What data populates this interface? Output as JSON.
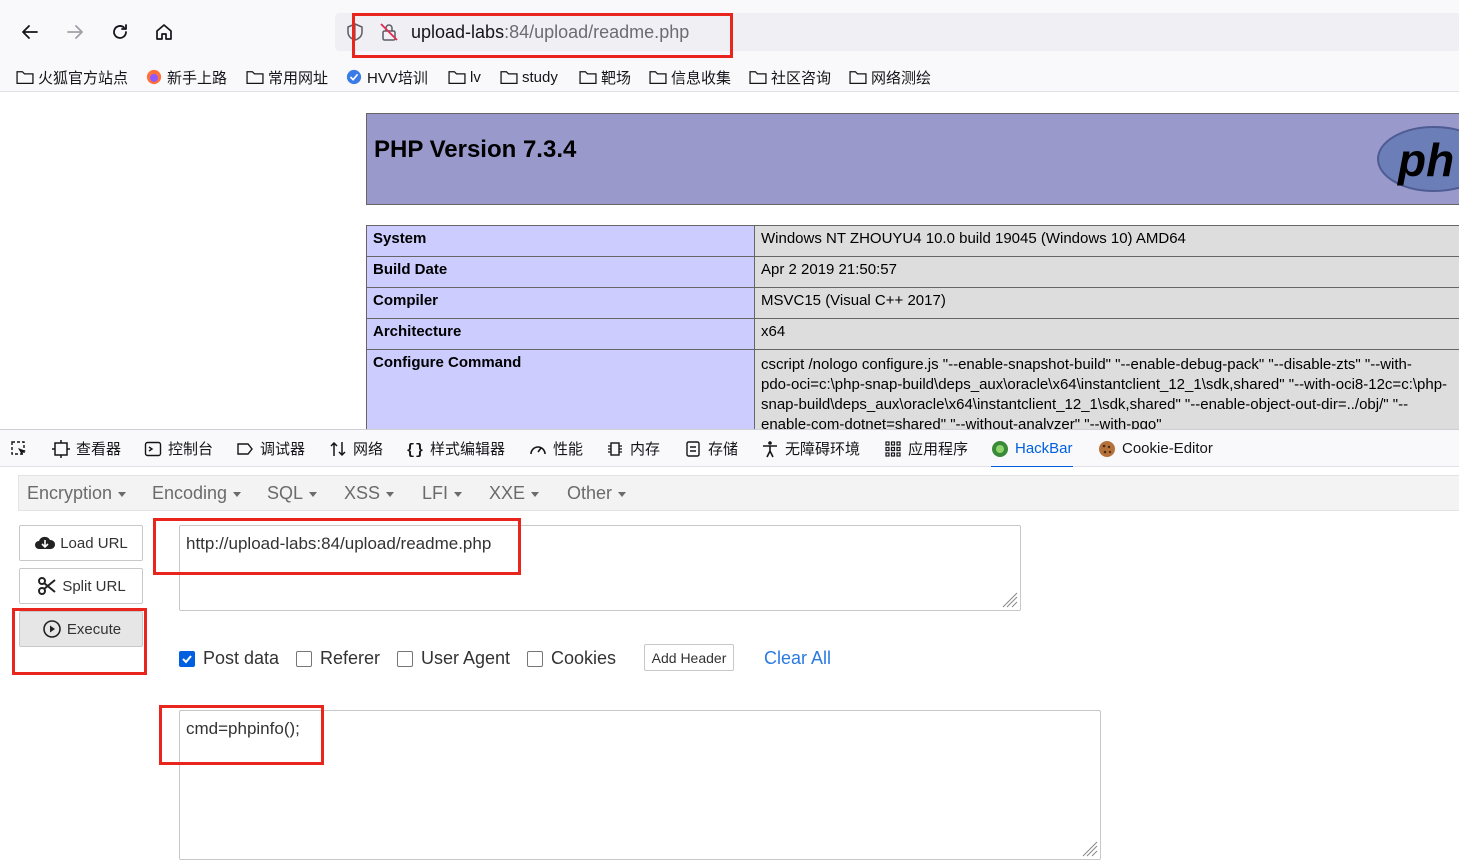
{
  "browser": {
    "url_host": "upload-labs",
    "url_rest": ":84/upload/readme.php",
    "bookmarks": [
      "火狐官方站点",
      "新手上路",
      "常用网址",
      "HVV培训",
      "lv",
      "study",
      "靶场",
      "信息收集",
      "社区咨询",
      "网络测绘"
    ]
  },
  "phpinfo": {
    "title": "PHP Version 7.3.4",
    "rows": [
      {
        "key": "System",
        "value": "Windows NT ZHOUYU4 10.0 build 19045 (Windows 10) AMD64"
      },
      {
        "key": "Build Date",
        "value": "Apr 2 2019 21:50:57"
      },
      {
        "key": "Compiler",
        "value": "MSVC15 (Visual C++ 2017)"
      },
      {
        "key": "Architecture",
        "value": "x64"
      }
    ],
    "configure": {
      "key": "Configure Command",
      "lines": [
        "cscript /nologo configure.js \"--enable-snapshot-build\" \"--enable-debug-pack\" \"--disable-zts\" \"--with-",
        "pdo-oci=c:\\php-snap-build\\deps_aux\\oracle\\x64\\instantclient_12_1\\sdk,shared\" \"--with-oci8-12c=c:\\php-",
        "snap-build\\deps_aux\\oracle\\x64\\instantclient_12_1\\sdk,shared\" \"--enable-object-out-dir=../obj/\" \"--",
        "enable-com-dotnet=shared\" \"",
        "--without-analyzer",
        "\" \"--with-pgo\""
      ]
    }
  },
  "devtools": {
    "tabs": [
      "查看器",
      "控制台",
      "调试器",
      "网络",
      "样式编辑器",
      "性能",
      "内存",
      "存储",
      "无障碍环境",
      "应用程序",
      "HackBar",
      "Cookie-Editor"
    ]
  },
  "hackbar": {
    "menu": [
      "Encryption",
      "Encoding",
      "SQL",
      "XSS",
      "LFI",
      "XXE",
      "Other"
    ],
    "load_url": "Load URL",
    "split_url": "Split URL",
    "execute": "Execute",
    "url_value": "http://upload-labs:84/upload/readme.php",
    "post_data": "Post data",
    "referer": "Referer",
    "user_agent": "User Agent",
    "cookies": "Cookies",
    "add_header": "Add Header",
    "clear_all": "Clear All",
    "body_value": "cmd=phpinfo();"
  },
  "colors": {
    "annotation_red": "#e8261e",
    "php_header": "#9999cc",
    "php_key": "#ccccff",
    "php_value": "#dddddd",
    "devtools_active": "#0060df"
  }
}
